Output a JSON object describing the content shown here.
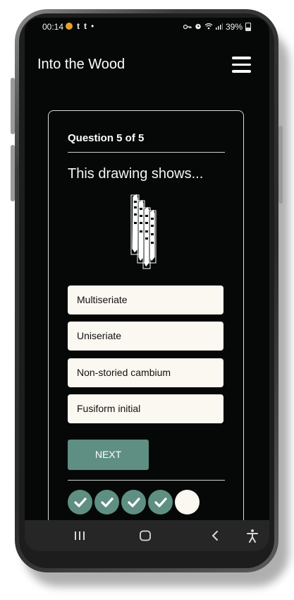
{
  "status_bar": {
    "time": "00:14",
    "notif_t1": "t",
    "notif_t2": "t",
    "notif_dot": "•",
    "battery": "39%"
  },
  "header": {
    "title": "Into the Wood"
  },
  "quiz": {
    "question_label": "Question 5 of 5",
    "question_text": "This drawing shows...",
    "answers": [
      {
        "label": "Multiseriate"
      },
      {
        "label": "Uniseriate"
      },
      {
        "label": "Non-storied cambium"
      },
      {
        "label": "Fusiform initial"
      }
    ],
    "next_label": "NEXT",
    "progress": {
      "completed": 4,
      "total": 5
    }
  },
  "colors": {
    "background": "#050807",
    "accent": "#5f8f82",
    "answer_bg": "#fbf8f1"
  },
  "icons": [
    "hamburger-menu-icon",
    "check-icon",
    "recent-apps-icon",
    "home-icon",
    "back-icon",
    "accessibility-icon"
  ]
}
